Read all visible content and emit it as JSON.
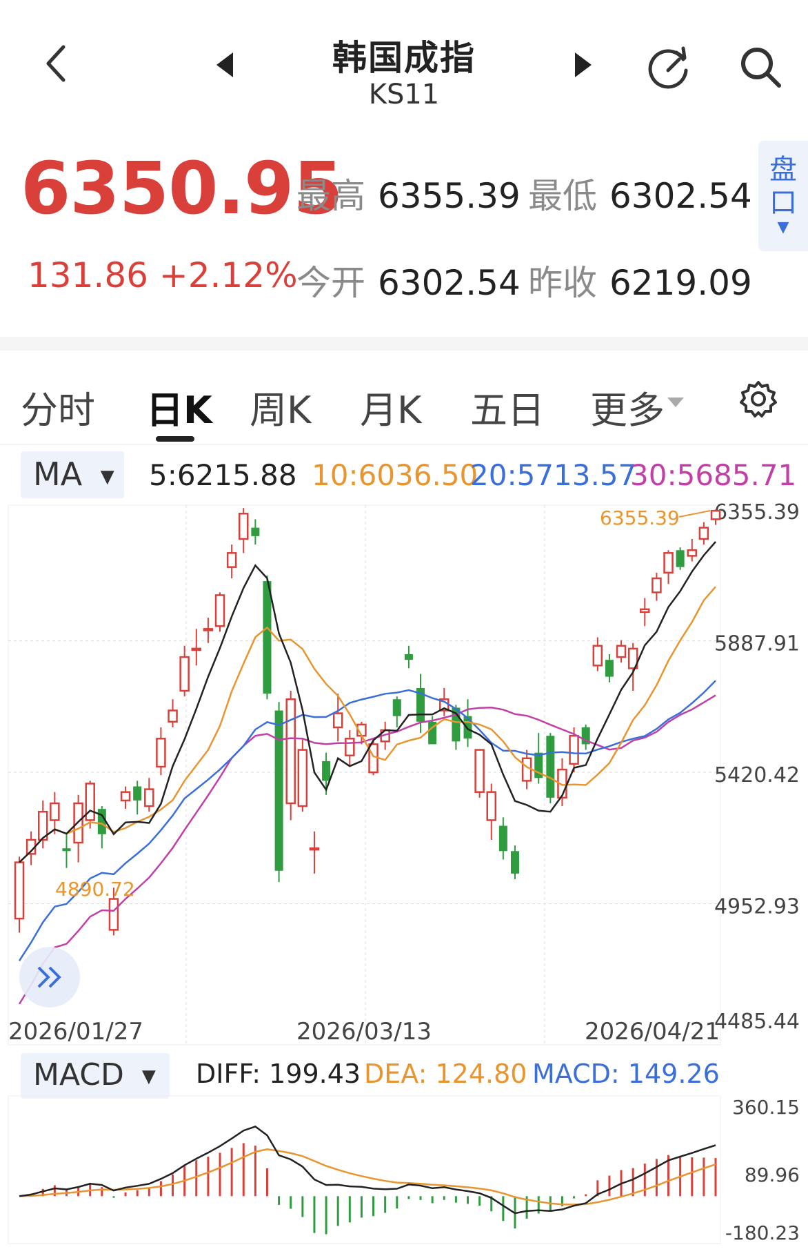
{
  "header": {
    "title": "韩国成指",
    "code": "KS11"
  },
  "quote": {
    "price": "6350.95",
    "change": "131.86 +2.12%",
    "high_label": "最高",
    "high": "6355.39",
    "low_label": "最低",
    "low": "6302.54",
    "open_label": "今开",
    "open": "6302.54",
    "prev_label": "昨收",
    "prev": "6219.09",
    "pankou": "盘口"
  },
  "tabs": [
    "分时",
    "日K",
    "周K",
    "月K",
    "五日",
    "更多"
  ],
  "active_tab": 1,
  "colors": {
    "up": "#d9403a",
    "down": "#2f9c3f",
    "ma5": "#222222",
    "ma10": "#e8952f",
    "ma20": "#3a6ed8",
    "ma30": "#c23fa8",
    "accent": "#3a6ed8"
  },
  "ma_legend": {
    "selector": "MA",
    "ma5": "5:6215.88",
    "ma10": "10:6036.50",
    "ma20": "20:5713.57",
    "ma30": "30:5685.71"
  },
  "macd_legend": {
    "selector": "MACD",
    "diff": "DIFF: 199.43",
    "dea": "DEA: 124.80",
    "macd": "MACD: 149.26"
  },
  "chart_data": [
    {
      "type": "candlestick",
      "y_ticks": [
        "6355.39",
        "5887.91",
        "5420.42",
        "4952.93",
        "4485.44"
      ],
      "ylim": [
        4485.44,
        6355.39
      ],
      "x_labels": [
        "2026/01/27",
        "2026/03/13",
        "2026/04/21"
      ],
      "annotations": {
        "max": "6355.39",
        "min": "4890.72"
      },
      "candles": [
        [
          4900,
          5100,
          4850,
          5120
        ],
        [
          5130,
          5180,
          5090,
          5210
        ],
        [
          5180,
          5280,
          5150,
          5320
        ],
        [
          5250,
          5310,
          5200,
          5350
        ],
        [
          5150,
          5140,
          5080,
          5200
        ],
        [
          5170,
          5310,
          5100,
          5340
        ],
        [
          5250,
          5380,
          5220,
          5390
        ],
        [
          5290,
          5200,
          5150,
          5300
        ],
        [
          4860,
          4970,
          4840,
          5010
        ],
        [
          5320,
          5350,
          5290,
          5370
        ],
        [
          5370,
          5320,
          5270,
          5390
        ],
        [
          5300,
          5360,
          5280,
          5400
        ],
        [
          5440,
          5540,
          5410,
          5580
        ],
        [
          5600,
          5640,
          5580,
          5680
        ],
        [
          5710,
          5830,
          5690,
          5870
        ],
        [
          5860,
          5860,
          5800,
          5930
        ],
        [
          5930,
          5930,
          5880,
          5970
        ],
        [
          5940,
          6050,
          5920,
          6060
        ],
        [
          6150,
          6200,
          6110,
          6230
        ],
        [
          6250,
          6340,
          6200,
          6360
        ],
        [
          6290,
          6260,
          6230,
          6320
        ],
        [
          6100,
          5700,
          5680,
          6120
        ],
        [
          5640,
          5070,
          5030,
          5670
        ],
        [
          5310,
          5680,
          5250,
          5710
        ],
        [
          5300,
          5500,
          5280,
          5540
        ],
        [
          5150,
          5150,
          5060,
          5210
        ],
        [
          5460,
          5390,
          5340,
          5490
        ],
        [
          5580,
          5630,
          5530,
          5700
        ],
        [
          5480,
          5540,
          5440,
          5570
        ],
        [
          5550,
          5590,
          5520,
          5600
        ],
        [
          5420,
          5520,
          5410,
          5540
        ],
        [
          5530,
          5570,
          5500,
          5600
        ],
        [
          5680,
          5620,
          5580,
          5690
        ],
        [
          5840,
          5820,
          5790,
          5870
        ],
        [
          5720,
          5600,
          5560,
          5770
        ],
        [
          5600,
          5520,
          5590,
          5620
        ],
        [
          5640,
          5680,
          5620,
          5720
        ],
        [
          5650,
          5530,
          5500,
          5660
        ],
        [
          5620,
          5540,
          5510,
          5680
        ],
        [
          5350,
          5500,
          5330,
          5500
        ],
        [
          5250,
          5350,
          5180,
          5380
        ],
        [
          5230,
          5140,
          5110,
          5260
        ],
        [
          5140,
          5060,
          5040,
          5160
        ],
        [
          5390,
          5470,
          5360,
          5500
        ],
        [
          5490,
          5400,
          5380,
          5560
        ],
        [
          5550,
          5330,
          5310,
          5560
        ],
        [
          5330,
          5430,
          5300,
          5470
        ],
        [
          5450,
          5550,
          5420,
          5580
        ],
        [
          5580,
          5520,
          5500,
          5590
        ],
        [
          5800,
          5870,
          5780,
          5900
        ],
        [
          5820,
          5760,
          5740,
          5840
        ],
        [
          5830,
          5870,
          5810,
          5890
        ],
        [
          5790,
          5860,
          5710,
          5880
        ],
        [
          5990,
          6000,
          5940,
          6040
        ],
        [
          6060,
          6110,
          6030,
          6130
        ],
        [
          6130,
          6200,
          6090,
          6210
        ],
        [
          6210,
          6150,
          6140,
          6220
        ],
        [
          6190,
          6210,
          6170,
          6250
        ],
        [
          6250,
          6290,
          6230,
          6310
        ],
        [
          6320,
          6350,
          6300,
          6355
        ]
      ]
    },
    {
      "type": "macd",
      "y_ticks": [
        "360.15",
        "89.96",
        "-180.23"
      ],
      "ylim": [
        -180.23,
        360.15
      ],
      "diff_end": 199.43,
      "dea_end": 124.8,
      "macd_end": 149.26
    }
  ]
}
